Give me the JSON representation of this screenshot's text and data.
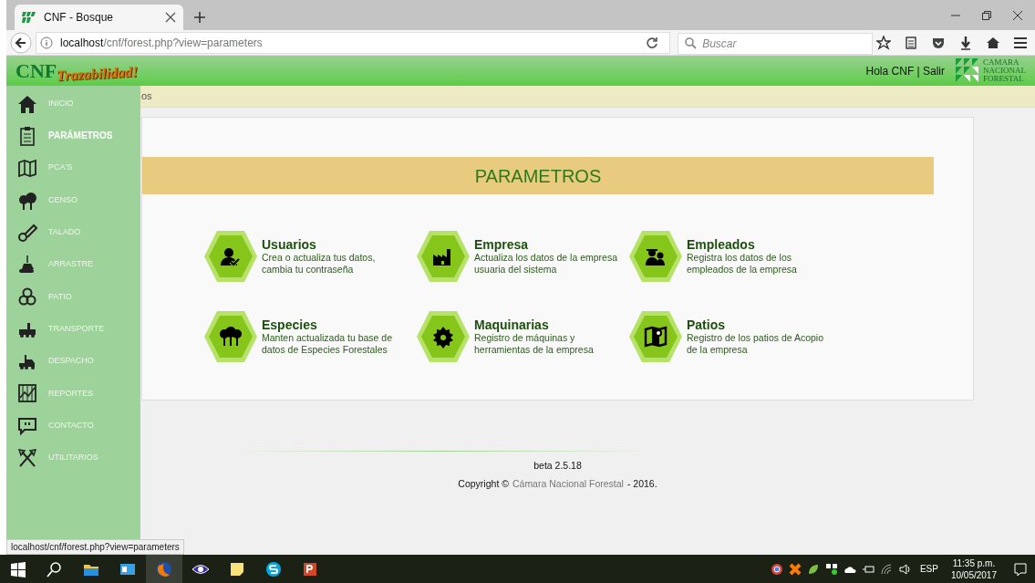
{
  "browser": {
    "tab_title": "CNF - Bosque",
    "address": {
      "host": "localhost",
      "path": "/cnf/forest.php?view=parameters"
    },
    "search_placeholder": "Buscar",
    "status_url": "localhost/cnf/forest.php?view=parameters"
  },
  "header": {
    "logo": "CNF",
    "logo_tagline": "Trazabilidad!",
    "user_links": "Hola CNF | Salir",
    "org_logo_lines": [
      "CAMARA",
      "NACIONAL",
      "FORESTAL"
    ]
  },
  "breadcrumb": "os",
  "sidebar": {
    "items": [
      {
        "label": "INICIO",
        "selected": false
      },
      {
        "label": "PARÁMETROS",
        "selected": true
      },
      {
        "label": "PCA'S",
        "selected": false
      },
      {
        "label": "CENSO",
        "selected": false
      },
      {
        "label": "TALADO",
        "selected": false
      },
      {
        "label": "ARRASTRE",
        "selected": false
      },
      {
        "label": "PATIO",
        "selected": false
      },
      {
        "label": "TRANSPORTE",
        "selected": false
      },
      {
        "label": "DESPACHO",
        "selected": false
      },
      {
        "label": "REPORTES",
        "selected": false
      },
      {
        "label": "CONTACTO",
        "selected": false
      },
      {
        "label": "UTILITARIOS",
        "selected": false
      }
    ]
  },
  "panel": {
    "title": "PARAMETROS",
    "cards": [
      {
        "title": "Usuarios",
        "description": "Crea o actualiza tus datos, cambia tu contraseña"
      },
      {
        "title": "Empresa",
        "description": "Actualiza los datos de la empresa usuaria del sistema"
      },
      {
        "title": "Empleados",
        "description": "Registra los datos de los empleados de la empresa"
      },
      {
        "title": "Especies",
        "description": "Manten actualizada tu base de datos de Especies Forestales"
      },
      {
        "title": "Maquinarias",
        "description": "Registro de máquinas y herramientas de la empresa"
      },
      {
        "title": "Patios",
        "description": "Registro de los patios de Acopio de la empresa"
      }
    ]
  },
  "footer": {
    "version": "beta 2.5.18",
    "copyright_prefix": "Copyright ©",
    "copyright_link": "Cámara Nacional Forestal",
    "copyright_suffix": "- 2016."
  },
  "taskbar": {
    "language": "ESP",
    "time": "11:35 p.m.",
    "date": "10/05/2017"
  }
}
